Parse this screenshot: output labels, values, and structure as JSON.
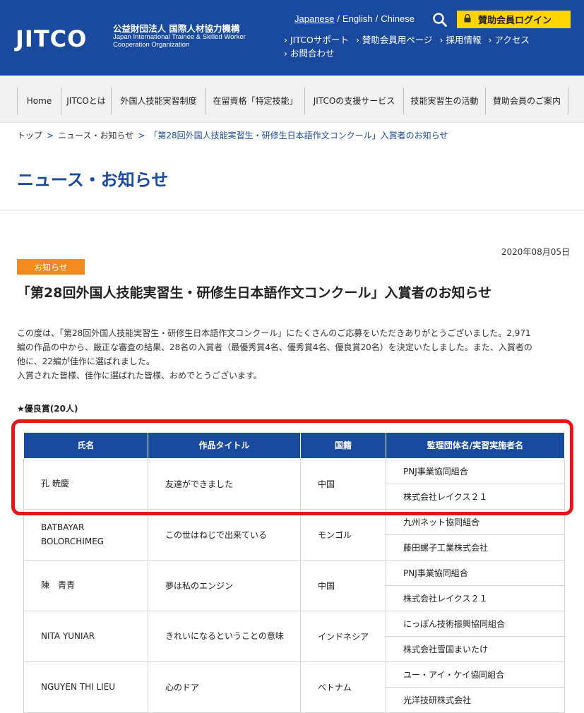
{
  "header": {
    "logo": "JITCO",
    "org_jp": "公益財団法人 国際人材協力機構",
    "org_en_line1": "Japan International Trainee & Skilled Worker",
    "org_en_line2": "Cooperation Organization",
    "languages": [
      "Japanese",
      "English",
      "Chinese"
    ],
    "active_language": "Japanese",
    "login_label": "賛助会員ログイン",
    "quick_links": [
      "› JITCOサポート",
      "› 賛助会員用ページ",
      "› 採用情報",
      "› アクセス",
      "› お問合わせ"
    ]
  },
  "nav": {
    "items": [
      "Home",
      "JITCOとは",
      "外国人技能実習制度",
      "在留資格「特定技能」",
      "JITCOの支援サービス",
      "技能実習生の活動",
      "賛助会員のご案内"
    ]
  },
  "breadcrumb": {
    "items": [
      "トップ",
      "ニュース・お知らせ",
      "「第28回外国人技能実習生・研修生日本語作文コンクール」入賞者のお知らせ"
    ]
  },
  "page_title": "ニュース・お知らせ",
  "article": {
    "date": "2020年08月05日",
    "category": "お知らせ",
    "title": "「第28回外国人技能実習生・研修生日本語作文コンクール」入賞者のお知らせ",
    "intro_line1": "この度は、「第28回外国人技能実習生・研修生日本語作文コンクール」にたくさんのご応募をいただきありがとうございました。2,971",
    "intro_line2": "編の作品の中から、厳正な審査の結果、28名の入賞者（最優秀賞4名、優秀賞4名、優良賞20名）を決定いたしました。また、入賞者の",
    "intro_line3": "他に、22編が佳作に選ばれました。",
    "intro_line4": "入賞された皆様、佳作に選ばれた皆様、おめでとうございます。",
    "section_heading": "★優良賞(20人)"
  },
  "table": {
    "headers": [
      "氏名",
      "作品タイトル",
      "国籍",
      "監理団体名/実習実施者名"
    ],
    "rows": [
      {
        "name": "孔 暁慶",
        "title": "友達ができました",
        "nationality": "中国",
        "org1": "PNJ事業協同組合",
        "org2": "株式会社レイクス２１"
      },
      {
        "name": "BATBAYAR BOLORCHIMEG",
        "title": "この世はねじで出来ている",
        "nationality": "モンゴル",
        "org1": "九州ネット協同組合",
        "org2": "藤田螺子工業株式会社"
      },
      {
        "name": "陳　青青",
        "title": "夢は私のエンジン",
        "nationality": "中国",
        "org1": "PNJ事業協同組合",
        "org2": "株式会社レイクス２１"
      },
      {
        "name": "NITA YUNIAR",
        "title": "きれいになるということの意味",
        "nationality": "インドネシア",
        "org1": "にっぽん技術振興協同組合",
        "org2": "株式会社雪国まいたけ"
      },
      {
        "name": "NGUYEN THI LIEU",
        "title": "心のドア",
        "nationality": "ベトナム",
        "org1": "ユー・アイ・ケイ協同組合",
        "org2": "光洋技研株式会社"
      }
    ]
  },
  "colors": {
    "brand_blue": "#1a4a9e",
    "accent_yellow": "#ffd400",
    "badge_orange": "#f28a1f",
    "highlight_red": "#e21818"
  }
}
